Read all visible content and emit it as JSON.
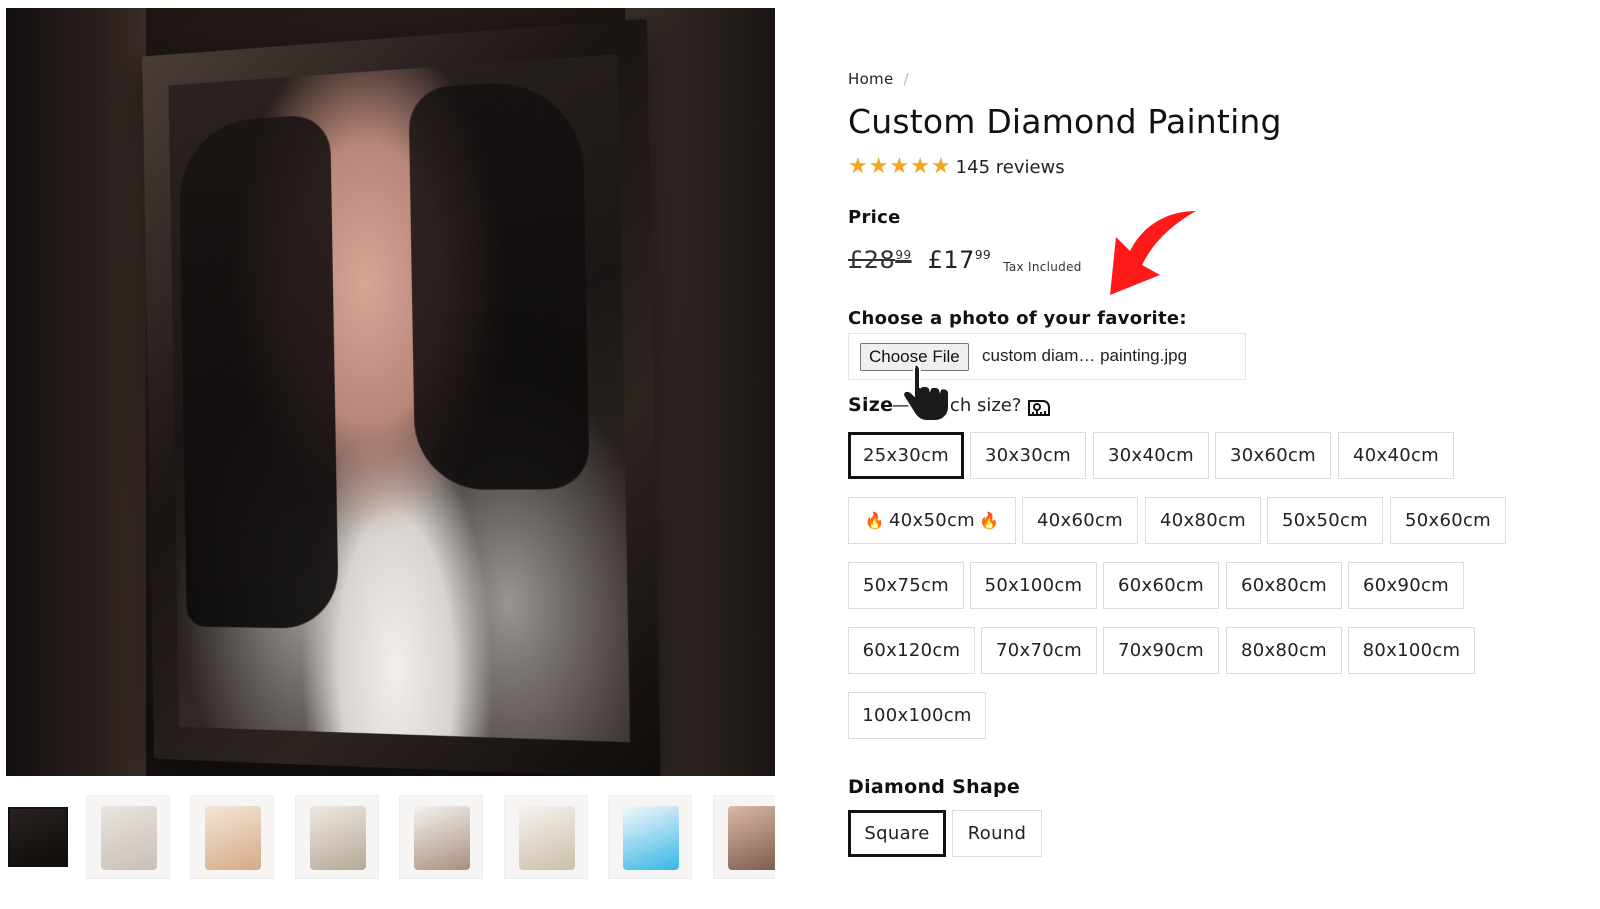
{
  "gallery": {
    "main_image_alt": "",
    "thumbnail_count": 8
  },
  "breadcrumb": {
    "home": "Home",
    "separator": "/"
  },
  "product": {
    "title": "Custom Diamond Painting",
    "rating_stars": 5,
    "reviews": "145 reviews"
  },
  "price": {
    "label": "Price",
    "old_main": "£28",
    "old_cents": "99",
    "new_main": "£17",
    "new_cents": "99",
    "tax_note": "Tax Included"
  },
  "upload": {
    "label": "Choose a photo of your favorite:",
    "button": "Choose File",
    "file_name": "custom diam… painting.jpg"
  },
  "size": {
    "label": "Size",
    "help": "— Which size?",
    "options": [
      {
        "label": "25x30cm",
        "selected": true
      },
      {
        "label": "30x30cm"
      },
      {
        "label": "30x40cm"
      },
      {
        "label": "30x60cm"
      },
      {
        "label": "40x40cm"
      },
      {
        "label": "40x50cm",
        "hot": true
      },
      {
        "label": "40x60cm"
      },
      {
        "label": "40x80cm"
      },
      {
        "label": "50x50cm"
      },
      {
        "label": "50x60cm"
      },
      {
        "label": "50x75cm"
      },
      {
        "label": "50x100cm"
      },
      {
        "label": "60x60cm"
      },
      {
        "label": "60x80cm"
      },
      {
        "label": "60x90cm"
      },
      {
        "label": "60x120cm"
      },
      {
        "label": "70x70cm"
      },
      {
        "label": "70x90cm"
      },
      {
        "label": "80x80cm"
      },
      {
        "label": "80x100cm"
      },
      {
        "label": "100x100cm"
      }
    ]
  },
  "shape": {
    "label": "Diamond Shape",
    "options": [
      {
        "label": "Square",
        "selected": true
      },
      {
        "label": "Round"
      }
    ]
  },
  "colors": {
    "star": "#f5a623",
    "annotation_arrow": "#ff1a1a",
    "flame": "#f08a1c",
    "selected_border": "#111111"
  }
}
